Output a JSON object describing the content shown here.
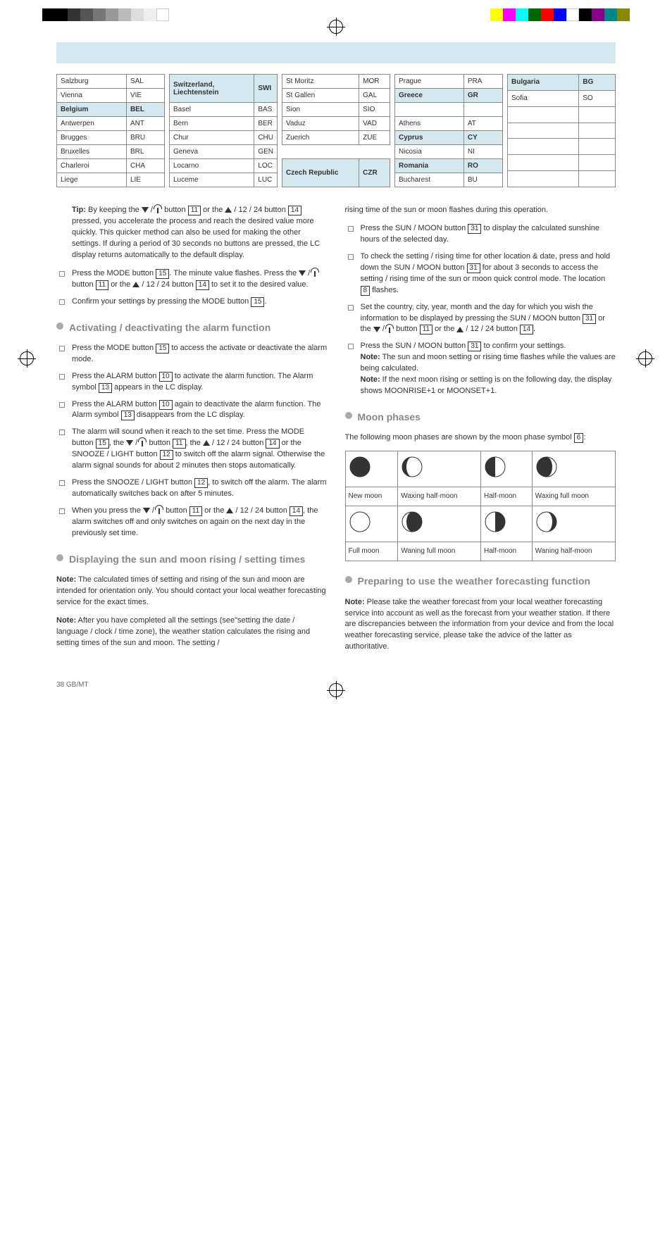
{
  "tables": {
    "t1": {
      "rows": [
        [
          "Salzburg",
          "SAL"
        ],
        [
          "Vienna",
          "VIE"
        ]
      ],
      "header": [
        "Belgium",
        "BEL"
      ],
      "rows2": [
        [
          "Antwerpen",
          "ANT"
        ],
        [
          "Brugges",
          "BRU"
        ],
        [
          "Bruxelles",
          "BRL"
        ],
        [
          "Charleroi",
          "CHA"
        ],
        [
          "Liege",
          "LIE"
        ]
      ]
    },
    "t2": {
      "header": [
        "Switzerland, Liechtenstein",
        "SWI"
      ],
      "rows": [
        [
          "Basel",
          "BAS"
        ],
        [
          "Bern",
          "BER"
        ],
        [
          "Chur",
          "CHU"
        ],
        [
          "Geneva",
          "GEN"
        ],
        [
          "Locarno",
          "LOC"
        ],
        [
          "Luceme",
          "LUC"
        ]
      ]
    },
    "t3": {
      "rows": [
        [
          "St Moritz",
          "MOR"
        ],
        [
          "St Gallen",
          "GAL"
        ],
        [
          "Sion",
          "SIO"
        ],
        [
          "Vaduz",
          "VAD"
        ],
        [
          "Zuerich",
          "ZUE"
        ]
      ],
      "header": [
        "Czech Republic",
        "CZR"
      ]
    },
    "t4": {
      "rows": [
        [
          "Prague",
          "PRA"
        ]
      ],
      "h1": [
        "Greece",
        "GR"
      ],
      "rows2": [
        [
          "Athens",
          "AT"
        ]
      ],
      "h2": [
        "Cyprus",
        "CY"
      ],
      "rows3": [
        [
          "Nicosia",
          "NI"
        ]
      ],
      "h3": [
        "Romania",
        "RO"
      ],
      "rows4": [
        [
          "Bucharest",
          "BU"
        ]
      ]
    },
    "t5": {
      "header": [
        "Bulgaria",
        "BG"
      ],
      "rows": [
        [
          "Sofia",
          "SO"
        ],
        [
          "",
          ""
        ],
        [
          "",
          ""
        ],
        [
          "",
          ""
        ],
        [
          "",
          ""
        ],
        [
          "",
          ""
        ]
      ]
    }
  },
  "body": {
    "tip_label": "Tip:",
    "tip_text": " By keeping the ",
    "tip_text2": " button ",
    "ref11": "11",
    "tip_text3": " or the ",
    "tip_text4": " / 12 / 24 button ",
    "ref14": "14",
    "tip_text5": " pressed, you accelerate the process and reach the desired value more quickly. This quicker method can also be used for making the other settings. If during a period of 30 seconds no buttons are pressed, the LC display returns automatically to the default display.",
    "li1a": "Press the MODE button ",
    "ref15": "15",
    "li1b": ". The minute value flashes. Press the ",
    "li1c": " button ",
    "li1d": " or the ",
    "li1e": " / 12 / 24 button ",
    "li1f": " to set it to the desired value.",
    "li2a": "Confirm your settings by pressing the MODE button ",
    "li2b": ".",
    "sec1": "Activating / deactivating the alarm function",
    "s1_li1a": "Press the MODE button ",
    "s1_li1b": " to access the activate or deactivate the alarm mode.",
    "s1_li2a": "Press the ALARM button ",
    "ref10": "10",
    "s1_li2b": " to activate the alarm function. The Alarm symbol ",
    "ref13": "13",
    "s1_li2c": " appears in the LC display.",
    "s1_li3a": "Press the ALARM button ",
    "s1_li3b": " again to deactivate the alarm function. The Alarm symbol ",
    "s1_li3c": " disappears from the LC display.",
    "s1_li4a": "The alarm will sound when it reach to the set time. Press the MODE button ",
    "s1_li4b": ", the ",
    "s1_li4c": " button ",
    "s1_li4d": ", the ",
    "s1_li4e": " / 12 / 24 button ",
    "s1_li4f": " or the SNOOZE / LIGHT button ",
    "ref12": "12",
    "s1_li4g": " to switch off the alarm signal. Otherwise the alarm signal sounds for about 2 minutes then stops automatically.",
    "s1_li5a": "Press the SNOOZE / LIGHT button ",
    "s1_li5b": ", to switch off the alarm. The alarm automatically switches back on after 5 minutes.",
    "s1_li6a": "When you press the ",
    "s1_li6b": " button ",
    "s1_li6c": " or the ",
    "s1_li6d": " / 12 / 24 button ",
    "s1_li6e": ", the alarm switches off and only switches on again on the next day in the previously set time.",
    "sec2": "Displaying the sun and moon rising / setting times",
    "note_label": "Note:",
    "s2_p1": " The calculated times of setting and rising of the sun and moon are intended for orientation only. You should contact your local weather forecasting service for the exact times.",
    "s2_p2": " After you have completed all the settings (see\"setting the date / language / clock / time zone), the weather station calculates the rising and setting times of the sun and moon. The setting / ",
    "col2_p1": "rising time of the sun or moon flashes during this operation.",
    "c2_li1a": "Press the SUN / MOON button ",
    "ref31": "31",
    "c2_li1b": " to display the calculated sunshine hours of the selected day.",
    "c2_li2a": "To check the setting / rising time for other location & date, press and hold down the SUN / MOON button ",
    "c2_li2b": " for about 3 seconds to access the setting / rising time of the sun or moon quick control mode. The location ",
    "ref8": "8",
    "c2_li2c": " flashes.",
    "c2_li3a": "Set the country, city, year, month and the day for which you wish the information to be displayed by pressing the SUN / MOON button ",
    "c2_li3b": " or the ",
    "c2_li3c": " button ",
    "c2_li3d": " or the ",
    "c2_li3e": " / 12 / 24 button ",
    "c2_li3f": ".",
    "c2_li4a": "Press the SUN / MOON button ",
    "c2_li4b": " to confirm your settings.",
    "c2_note1": " The sun and moon setting or rising time flashes while the values are being calculated.",
    "c2_note2": " If the next moon rising or setting is on the following day, the display shows MOONRISE+1 or MOONSET+1.",
    "sec3": "Moon phases",
    "s3_p1a": "The following moon phases are shown by the moon phase symbol ",
    "ref6": "6",
    "s3_p1b": ":",
    "moon": {
      "r1": [
        "New moon",
        "Waxing half-moon",
        "Half-moon",
        "Waxing full moon"
      ],
      "r2": [
        "Full moon",
        "Waning full moon",
        "Half-moon",
        "Waning half-moon"
      ]
    },
    "sec4": "Preparing to use the weather forecasting function",
    "s4_p1": " Please take the weather forecast from your local weather forecasting service into account as well as the forecast from your weather station. If there are discrepancies between the information from your device and from the local weather forecasting service, please take the advice of the latter as authoritative."
  },
  "footer": "38   GB/MT"
}
